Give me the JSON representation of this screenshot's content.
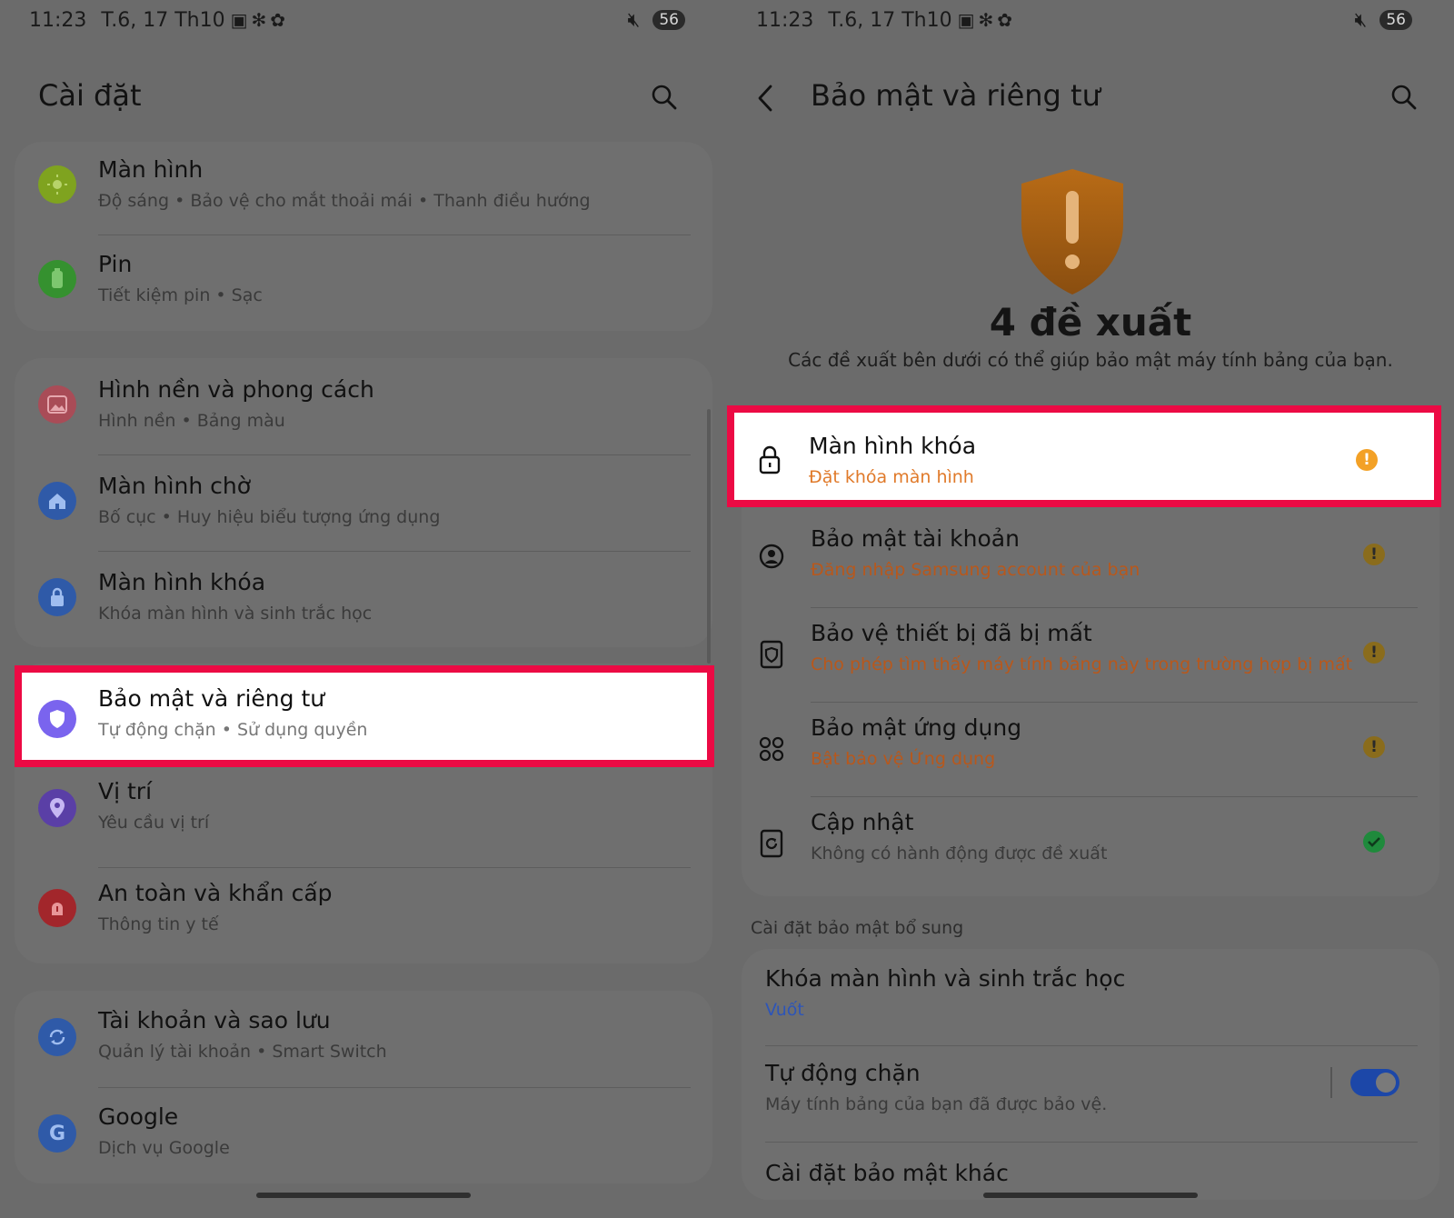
{
  "status": {
    "time": "11:23",
    "date": "T.6, 17 Th10",
    "battery": "56"
  },
  "left": {
    "title": "Cài đặt",
    "items": [
      {
        "title": "Màn hình",
        "subtitle": "Độ sáng • Bảo vệ cho mắt thoải mái • Thanh điều hướng",
        "icon": "sun-icon",
        "color": "#7fa31f"
      },
      {
        "title": "Pin",
        "subtitle": "Tiết kiệm pin • Sạc",
        "icon": "battery-icon",
        "color": "#35912f"
      },
      {
        "title": "Hình nền và phong cách",
        "subtitle": "Hình nền • Bảng màu",
        "icon": "image-icon",
        "color": "#a94c57"
      },
      {
        "title": "Màn hình chờ",
        "subtitle": "Bố cục • Huy hiệu biểu tượng ứng dụng",
        "icon": "home-icon",
        "color": "#2f5aa8"
      },
      {
        "title": "Màn hình khóa",
        "subtitle": "Khóa màn hình và sinh trắc học",
        "icon": "lock-icon",
        "color": "#2f5aa8"
      },
      {
        "title": "Bảo mật và riêng tư",
        "subtitle": "Tự động chặn • Sử dụng quyền",
        "icon": "shield-icon",
        "color": "#7a64ee"
      },
      {
        "title": "Vị trí",
        "subtitle": "Yêu cầu vị trí",
        "icon": "location-icon",
        "color": "#5a3fa6"
      },
      {
        "title": "An toàn và khẩn cấp",
        "subtitle": "Thông tin y tế",
        "icon": "emergency-icon",
        "color": "#a2262b"
      },
      {
        "title": "Tài khoản và sao lưu",
        "subtitle": "Quản lý tài khoản • Smart Switch",
        "icon": "sync-icon",
        "color": "#2f5aa8"
      },
      {
        "title": "Google",
        "subtitle": "Dịch vụ Google",
        "icon": "google-icon",
        "color": "#2f5aa8"
      }
    ]
  },
  "right": {
    "title": "Bảo mật và riêng tư",
    "suggest_count": "4 đề xuất",
    "suggest_desc": "Các đề xuất bên dưới có thể giúp bảo mật máy tính bảng của bạn.",
    "items": [
      {
        "title": "Màn hình khóa",
        "subtitle": "Đặt khóa màn hình",
        "icon": "lock-icon",
        "state": "warning"
      },
      {
        "title": "Bảo mật tài khoản",
        "subtitle": "Đăng nhập Samsung account của bạn",
        "icon": "account-icon",
        "state": "warning"
      },
      {
        "title": "Bảo vệ thiết bị đã bị mất",
        "subtitle": "Cho phép tìm thấy máy tính bảng này trong trường hợp bị mất",
        "icon": "find-device-icon",
        "state": "warning"
      },
      {
        "title": "Bảo mật ứng dụng",
        "subtitle": "Bật bảo vệ Ứng dụng",
        "icon": "apps-icon",
        "state": "warning"
      },
      {
        "title": "Cập nhật",
        "subtitle": "Không có hành động được đề xuất",
        "icon": "update-icon",
        "state": "ok"
      }
    ],
    "section_label": "Cài đặt bảo mật bổ sung",
    "extra": [
      {
        "title": "Khóa màn hình và sinh trắc học",
        "subtitle": "Vuốt"
      },
      {
        "title": "Tự động chặn",
        "subtitle": "Máy tính bảng của bạn đã được bảo vệ.",
        "toggle": true
      },
      {
        "title": "Cài đặt bảo mật khác"
      }
    ]
  },
  "colors": {
    "highlight": "#ec0a44",
    "warning_text": "#b8581c",
    "link": "#2d55b8",
    "toggle_on": "#1c47a8"
  }
}
